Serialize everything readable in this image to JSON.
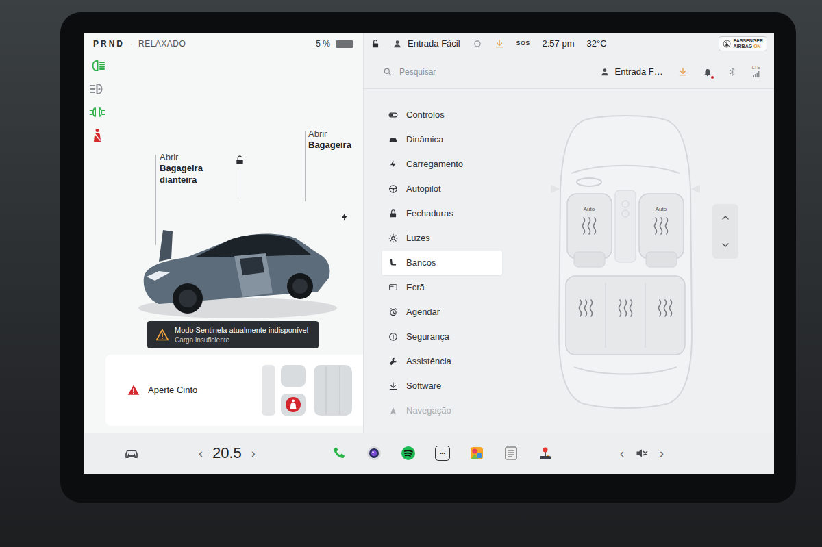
{
  "status_bar": {
    "gears": "PRND",
    "separator": "·",
    "drive_mode": "RELAXADO",
    "battery_text": "5 %",
    "battery_level": 0.05,
    "lock_open": true,
    "profile": "Entrada Fácil",
    "sos": "SOS",
    "time": "2:57 pm",
    "temperature": "32°C",
    "airbag": {
      "line1": "PASSENGER",
      "line2": "AIRBAG",
      "state": "ON"
    }
  },
  "indicators": [
    {
      "kind": "headlights",
      "color": "#2fb34a"
    },
    {
      "kind": "auto-high-beam",
      "color": "#8a8f94"
    },
    {
      "kind": "parking-lights",
      "color": "#2fb34a"
    },
    {
      "kind": "seatbelt",
      "color": "#d3262d"
    }
  ],
  "vehicle": {
    "front_trunk": {
      "action": "Abrir",
      "name": "Bagageira dianteira"
    },
    "rear_trunk": {
      "action": "Abrir",
      "name": "Bagageira"
    },
    "unlocked": true
  },
  "alert": {
    "title": "Modo Sentinela atualmente indisponível",
    "detail": "Carga insuficiente"
  },
  "seatbelt_warning": {
    "text": "Aperte Cinto"
  },
  "settings": {
    "search_placeholder": "Pesquisar",
    "profile": "Entrada F…",
    "notification_dot": true,
    "signal_label": "LTE",
    "menu": [
      {
        "label": "Controlos",
        "kind": "controls",
        "selected": false,
        "faded": false
      },
      {
        "label": "Dinâmica",
        "kind": "dynamics",
        "selected": false,
        "faded": false
      },
      {
        "label": "Carregamento",
        "kind": "charging",
        "selected": false,
        "faded": false
      },
      {
        "label": "Autopilot",
        "kind": "autopilot",
        "selected": false,
        "faded": false
      },
      {
        "label": "Fechaduras",
        "kind": "locks",
        "selected": false,
        "faded": false
      },
      {
        "label": "Luzes",
        "kind": "lights",
        "selected": false,
        "faded": false
      },
      {
        "label": "Bancos",
        "kind": "seats",
        "selected": true,
        "faded": false
      },
      {
        "label": "Ecrã",
        "kind": "display",
        "selected": false,
        "faded": false
      },
      {
        "label": "Agendar",
        "kind": "schedule",
        "selected": false,
        "faded": false
      },
      {
        "label": "Segurança",
        "kind": "safety",
        "selected": false,
        "faded": false
      },
      {
        "label": "Assistência",
        "kind": "service",
        "selected": false,
        "faded": false
      },
      {
        "label": "Software",
        "kind": "software",
        "selected": false,
        "faded": false
      },
      {
        "label": "Navegação",
        "kind": "navigation",
        "selected": false,
        "faded": true
      }
    ]
  },
  "seats": {
    "front": [
      {
        "label": "Auto"
      },
      {
        "label": "Auto"
      }
    ],
    "rear_heaters": 3
  },
  "bottom_bar": {
    "temp_down": "‹",
    "temperature": "20.5",
    "temp_up": "›",
    "apps": [
      {
        "kind": "phone",
        "label": ""
      },
      {
        "kind": "camera",
        "label": ""
      },
      {
        "kind": "spotify",
        "label": ""
      },
      {
        "kind": "more",
        "label": "•••"
      },
      {
        "kind": "toybox",
        "label": ""
      },
      {
        "kind": "notes",
        "label": ""
      },
      {
        "kind": "arcade",
        "label": ""
      }
    ],
    "media_prev": "‹",
    "muted": true,
    "media_next": "›"
  }
}
